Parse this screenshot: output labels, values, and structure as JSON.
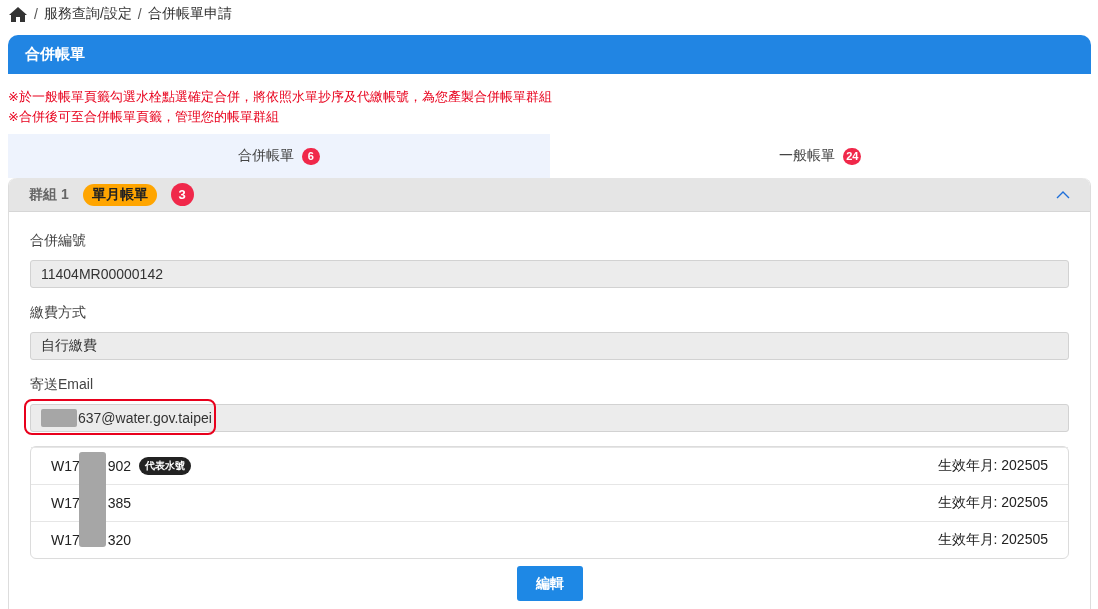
{
  "breadcrumb": [
    {
      "separator": "/",
      "label": "服務查詢/設定"
    },
    {
      "separator": "/",
      "label": "合併帳單申請"
    }
  ],
  "card": {
    "title": "合併帳單"
  },
  "notes": [
    "※於一般帳單頁籤勾選水栓點選確定合併，將依照水單抄序及代繳帳號，為您產製合併帳單群組",
    "※合併後可至合併帳單頁籤，管理您的帳單群組"
  ],
  "tabs": [
    {
      "label": "合併帳單",
      "count": "6",
      "selected": true
    },
    {
      "label": "一般帳單",
      "count": "24",
      "selected": false
    }
  ],
  "group": {
    "title": "群組 1",
    "tag": "單月帳單",
    "count": "3",
    "expanded": true,
    "fields": [
      {
        "label": "合併編號",
        "value": "11404MR00000142",
        "redacted": false,
        "highlighted": false
      },
      {
        "label": "繳費方式",
        "value": "自行繳費",
        "redacted": false,
        "highlighted": false
      },
      {
        "label": "寄送Email",
        "value": "637@water.gov.taipei",
        "redacted": true,
        "highlighted": true
      }
    ],
    "accounts": [
      {
        "number_start": "W17",
        "number_end": "902",
        "tag": "代表水號",
        "effective": "生效年月: 202505"
      },
      {
        "number_start": "W17",
        "number_end": "385",
        "effective": "生效年月: 202505"
      },
      {
        "number_start": "W17",
        "number_end": "320",
        "effective": "生效年月: 202505"
      }
    ],
    "button": "編輯"
  }
}
